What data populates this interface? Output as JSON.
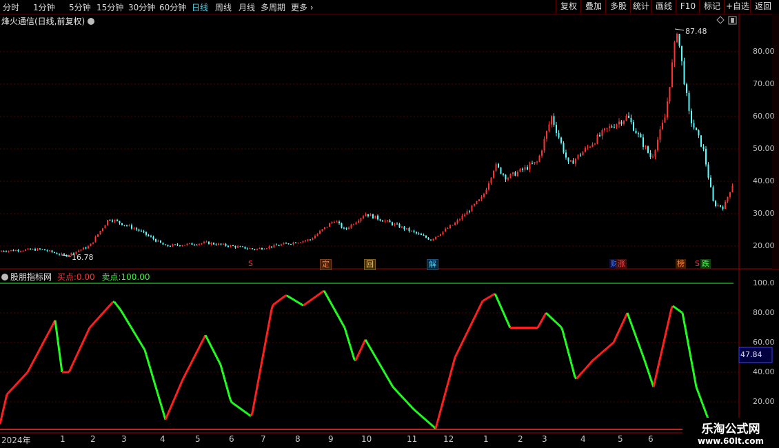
{
  "toolbar": {
    "timeframes": [
      "分时",
      "1分钟",
      "5分钟",
      "15分钟",
      "30分钟",
      "60分钟",
      "日线",
      "周线",
      "月线",
      "多周期",
      "更多"
    ],
    "active": "日线",
    "right_buttons": [
      "复权",
      "叠加",
      "多股",
      "统计",
      "画线",
      "F10",
      "标记",
      "+自选",
      "返回"
    ]
  },
  "stock": {
    "title": "烽火通信(日线,前复权)",
    "high_label": "87.48",
    "low_label": "16.78"
  },
  "price_axis": [
    "80.00",
    "70.00",
    "60.00",
    "50.00",
    "40.00",
    "30.00",
    "20.00"
  ],
  "markers": [
    {
      "text": "S",
      "color": "#ff3030"
    },
    {
      "text": "定",
      "color": "#ff8040"
    },
    {
      "text": "回",
      "color": "#ffd080"
    },
    {
      "text": "解",
      "color": "#40d0ff"
    },
    {
      "text": "财",
      "color": "#4080ff"
    },
    {
      "text": "涨",
      "color": "#ff4040"
    },
    {
      "text": "榜",
      "color": "#ff8040"
    },
    {
      "text": "S",
      "color": "#ff3030"
    },
    {
      "text": "跌",
      "color": "#40ff40"
    }
  ],
  "indicator": {
    "name": "股朋指标网",
    "buy_label": "买点:",
    "buy_value": "0.00",
    "sell_label": "卖点:",
    "sell_value": "100.00",
    "axis": [
      "100.0",
      "80.00",
      "60.00",
      "40.00",
      "20.00"
    ],
    "current": "47.84"
  },
  "dates": [
    "2024年",
    "1",
    "2",
    "3",
    "4",
    "5",
    "6",
    "7",
    "8",
    "9",
    "10",
    "11",
    "12",
    "1",
    "2",
    "3",
    "4",
    "5",
    "6"
  ],
  "watermark": {
    "line1": "乐淘公式网",
    "line2": "www.60lt.com"
  },
  "colors": {
    "up": "#ff3232",
    "down": "#54ffff",
    "ind_up": "#ff2020",
    "ind_down": "#20ff20",
    "grid": "#7a0000"
  }
}
